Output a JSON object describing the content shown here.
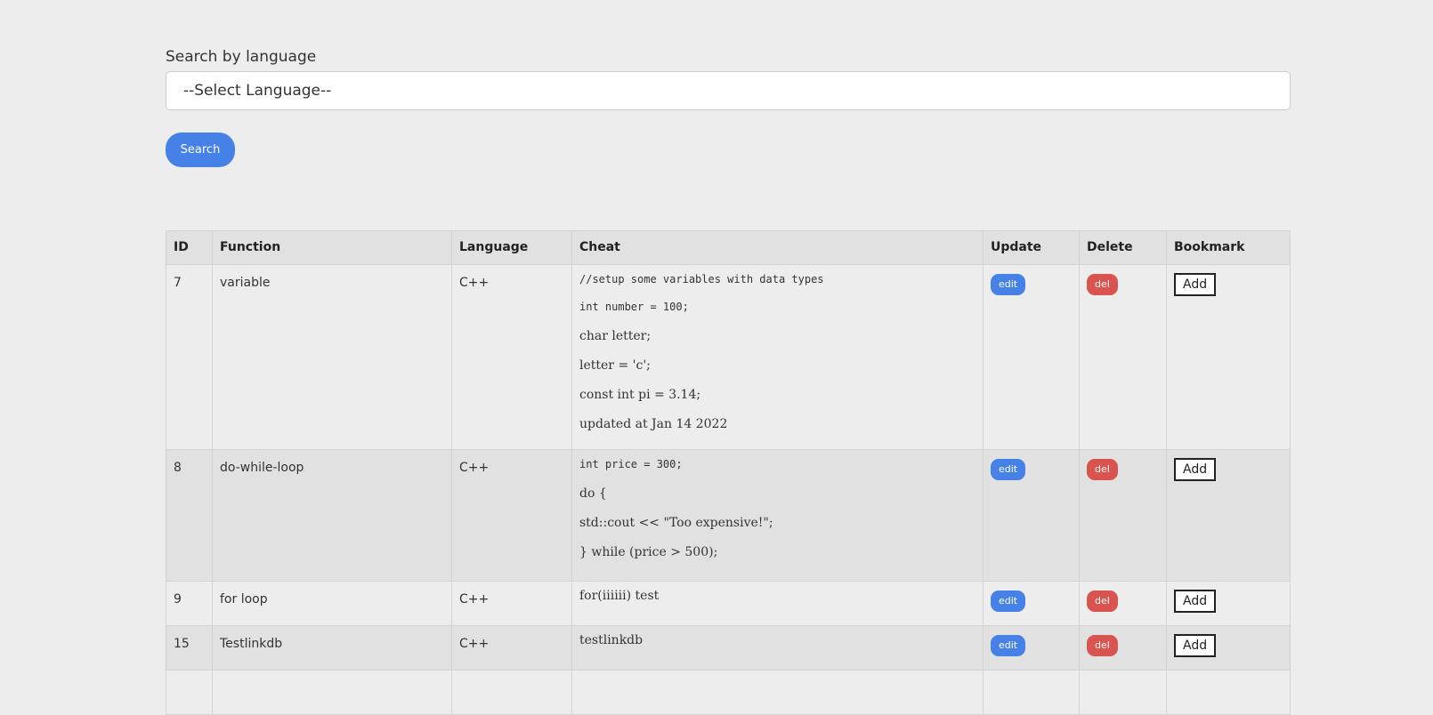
{
  "search": {
    "label": "Search by language",
    "select_value": "--Select Language--",
    "button_label": "Search"
  },
  "table": {
    "headers": [
      "ID",
      "Function",
      "Language",
      "Cheat",
      "Update",
      "Delete",
      "Bookmark"
    ],
    "rows": [
      {
        "id": "7",
        "function": "variable",
        "language": "C++",
        "cheat_code": [
          "//setup some variables with data types",
          "int number = 100;"
        ],
        "cheat_text": [
          "char letter;",
          "letter = 'c';",
          "const int pi = 3.14;",
          "updated at Jan 14 2022"
        ],
        "edit": "edit",
        "del": "del",
        "bookmark": "Add"
      },
      {
        "id": "8",
        "function": "do-while-loop",
        "language": "C++",
        "cheat_code": [
          "int price = 300;"
        ],
        "cheat_text": [
          "do {",
          "std::cout << \"Too expensive!\";",
          "} while (price > 500);"
        ],
        "edit": "edit",
        "del": "del",
        "bookmark": "Add"
      },
      {
        "id": "9",
        "function": "for loop",
        "language": "C++",
        "cheat_code": [],
        "cheat_text": [
          "for(iiiiii) test"
        ],
        "edit": "edit",
        "del": "del",
        "bookmark": "Add"
      },
      {
        "id": "15",
        "function": "Testlinkdb",
        "language": "C++",
        "cheat_code": [],
        "cheat_text": [
          "testlinkdb"
        ],
        "edit": "edit",
        "del": "del",
        "bookmark": "Add"
      }
    ]
  },
  "colors": {
    "background": "#ededed",
    "primary": "#4581e6",
    "danger": "#d9534f"
  }
}
